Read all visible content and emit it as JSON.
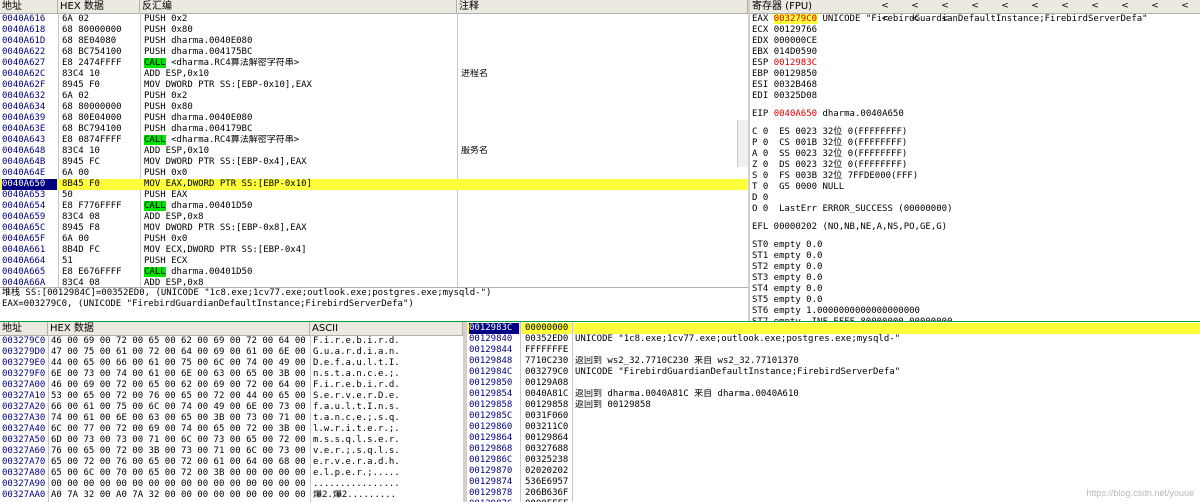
{
  "disasm": {
    "headers": {
      "addr": "地址",
      "hex": "HEX 数据",
      "asm": "反汇编",
      "comment": "注释"
    },
    "rows": [
      {
        "a": "0040A616",
        "h": "6A 02",
        "i": "PUSH 0x2",
        "c": ""
      },
      {
        "a": "0040A618",
        "h": "68 80000000",
        "i": "PUSH 0x80",
        "c": ""
      },
      {
        "a": "0040A61D",
        "h": "68 8E04080",
        "i": "PUSH dharma.0040E080",
        "c": ""
      },
      {
        "a": "0040A622",
        "h": "68 BC754100",
        "i": "PUSH dharma.004175BC",
        "c": ""
      },
      {
        "a": "0040A627",
        "h": "E8 2474FFFF",
        "i": "CALL <dharma.RC4算法解密字符串>",
        "c": "",
        "call": true
      },
      {
        "a": "0040A62C",
        "h": "83C4 10",
        "i": "ADD ESP,0x10",
        "c": "进程名"
      },
      {
        "a": "0040A62F",
        "h": "8945 F0",
        "i": "MOV DWORD PTR SS:[EBP-0x10],EAX",
        "c": ""
      },
      {
        "a": "0040A632",
        "h": "6A 02",
        "i": "PUSH 0x2",
        "c": ""
      },
      {
        "a": "0040A634",
        "h": "68 80000000",
        "i": "PUSH 0x80",
        "c": ""
      },
      {
        "a": "0040A639",
        "h": "68 80E04000",
        "i": "PUSH dharma.0040E080",
        "c": ""
      },
      {
        "a": "0040A63E",
        "h": "68 BC794100",
        "i": "PUSH dharma.004179BC",
        "c": ""
      },
      {
        "a": "0040A643",
        "h": "E8 0874FFFF",
        "i": "CALL <dharma.RC4算法解密字符串>",
        "c": "",
        "call": true
      },
      {
        "a": "0040A648",
        "h": "83C4 10",
        "i": "ADD ESP,0x10",
        "c": "服务名"
      },
      {
        "a": "0040A64B",
        "h": "8945 FC",
        "i": "MOV DWORD PTR SS:[EBP-0x4],EAX",
        "c": ""
      },
      {
        "a": "0040A64E",
        "h": "6A 00",
        "i": "PUSH 0x0",
        "c": ""
      },
      {
        "a": "0040A650",
        "h": "8B45 F0",
        "i": "MOV EAX,DWORD PTR SS:[EBP-0x10]",
        "c": "",
        "sel": true
      },
      {
        "a": "0040A653",
        "h": "50",
        "i": "PUSH EAX",
        "c": ""
      },
      {
        "a": "0040A654",
        "h": "E8 F776FFFF",
        "i": "CALL dharma.00401D50",
        "c": "",
        "call": true
      },
      {
        "a": "0040A659",
        "h": "83C4 08",
        "i": "ADD ESP,0x8",
        "c": ""
      },
      {
        "a": "0040A65C",
        "h": "8945 F8",
        "i": "MOV DWORD PTR SS:[EBP-0x8],EAX",
        "c": ""
      },
      {
        "a": "0040A65F",
        "h": "6A 00",
        "i": "PUSH 0x0",
        "c": ""
      },
      {
        "a": "0040A661",
        "h": "8B4D FC",
        "i": "MOV ECX,DWORD PTR SS:[EBP-0x4]",
        "c": ""
      },
      {
        "a": "0040A664",
        "h": "51",
        "i": "PUSH ECX",
        "c": ""
      },
      {
        "a": "0040A665",
        "h": "E8 E676FFFF",
        "i": "CALL dharma.00401D50",
        "c": "",
        "call": true
      },
      {
        "a": "0040A66A",
        "h": "83C4 08",
        "i": "ADD ESP,0x8",
        "c": ""
      }
    ]
  },
  "info": {
    "line1": "堆栈 SS:[0012984C]=00352ED0, (UNICODE \"1c8.exe;1cv77.exe;outlook.exe;postgres.exe;mysqld-\")",
    "line2": "EAX=003279C0, (UNICODE \"FirebirdGuardianDefaultInstance;FirebirdServerDefa\")"
  },
  "registers": {
    "title": "寄存器 (FPU)",
    "arrows": [
      "<",
      "<",
      "<",
      "<",
      "<",
      "<",
      "<",
      "<",
      "<",
      "<",
      "<",
      "<",
      "<",
      "<"
    ],
    "gp": [
      {
        "n": "EAX",
        "v": "003279C0",
        "x": "UNICODE \"FirebirdGuardianDefaultInstance;FirebirdServerDefa\"",
        "chg": true
      },
      {
        "n": "ECX",
        "v": "00129766",
        "x": ""
      },
      {
        "n": "EDX",
        "v": "000000CE",
        "x": ""
      },
      {
        "n": "EBX",
        "v": "014D0590",
        "x": ""
      },
      {
        "n": "ESP",
        "v": "0012983C",
        "x": "",
        "red": true
      },
      {
        "n": "EBP",
        "v": "00129850",
        "x": ""
      },
      {
        "n": "ESI",
        "v": "0032B468",
        "x": ""
      },
      {
        "n": "EDI",
        "v": "00325D08",
        "x": ""
      }
    ],
    "eip": {
      "n": "EIP",
      "v": "0040A650",
      "x": "dharma.0040A650"
    },
    "flags": [
      "C 0  ES 0023 32位 0(FFFFFFFF)",
      "P 0  CS 001B 32位 0(FFFFFFFF)",
      "A 0  SS 0023 32位 0(FFFFFFFF)",
      "Z 0  DS 0023 32位 0(FFFFFFFF)",
      "S 0  FS 003B 32位 7FFDE000(FFF)",
      "T 0  GS 0000 NULL",
      "D 0",
      "O 0  LastErr ERROR_SUCCESS (00000000)"
    ],
    "efl": "EFL 00000202 (NO,NB,NE,A,NS,PO,GE,G)",
    "fpu": [
      "ST0 empty 0.0",
      "ST1 empty 0.0",
      "ST2 empty 0.0",
      "ST3 empty 0.0",
      "ST4 empty 0.0",
      "ST5 empty 0.0",
      "ST6 empty 1.0000000000000000000",
      "ST7 empty -INF FFFF 80000000 00000000"
    ]
  },
  "dump": {
    "headers": {
      "addr": "地址",
      "hex": "HEX 数据",
      "ascii": "ASCII"
    },
    "rows": [
      {
        "a": "003279C0",
        "h": "46 00 69 00 72 00 65 00 62 00 69 00 72 00 64 00",
        "s": "F.i.r.e.b.i.r.d."
      },
      {
        "a": "003279D0",
        "h": "47 00 75 00 61 00 72 00 64 00 69 00 61 00 6E 00",
        "s": "G.u.a.r.d.i.a.n."
      },
      {
        "a": "003279E0",
        "h": "44 00 65 00 66 00 61 00 75 00 6C 00 74 00 49 00",
        "s": "D.e.f.a.u.l.t.I."
      },
      {
        "a": "003279F0",
        "h": "6E 00 73 00 74 00 61 00 6E 00 63 00 65 00 3B 00",
        "s": "n.s.t.a.n.c.e.;."
      },
      {
        "a": "00327A00",
        "h": "46 00 69 00 72 00 65 00 62 00 69 00 72 00 64 00",
        "s": "F.i.r.e.b.i.r.d."
      },
      {
        "a": "00327A10",
        "h": "53 00 65 00 72 00 76 00 65 00 72 00 44 00 65 00",
        "s": "S.e.r.v.e.r.D.e."
      },
      {
        "a": "00327A20",
        "h": "66 00 61 00 75 00 6C 00 74 00 49 00 6E 00 73 00",
        "s": "f.a.u.l.t.I.n.s."
      },
      {
        "a": "00327A30",
        "h": "74 00 61 00 6E 00 63 00 65 00 3B 00 73 00 71 00",
        "s": "t.a.n.c.e.;.s.q."
      },
      {
        "a": "00327A40",
        "h": "6C 00 77 00 72 00 69 00 74 00 65 00 72 00 3B 00",
        "s": "l.w.r.i.t.e.r.;."
      },
      {
        "a": "00327A50",
        "h": "6D 00 73 00 73 00 71 00 6C 00 73 00 65 00 72 00",
        "s": "m.s.s.q.l.s.e.r."
      },
      {
        "a": "00327A60",
        "h": "76 00 65 00 72 00 3B 00 73 00 71 00 6C 00 73 00",
        "s": "v.e.r.;.s.q.l.s."
      },
      {
        "a": "00327A70",
        "h": "65 00 72 00 76 00 65 00 72 00 61 00 64 00 68 00",
        "s": "e.r.v.e.r.a.d.h."
      },
      {
        "a": "00327A80",
        "h": "65 00 6C 00 70 00 65 00 72 00 3B 00 00 00 00 00",
        "s": "e.l.p.e.r.;....."
      },
      {
        "a": "00327A90",
        "h": "00 00 00 00 00 00 00 00 00 00 00 00 00 00 00 00",
        "s": "................"
      },
      {
        "a": "00327AA0",
        "h": "A0 7A 32 00 A0 7A 32 00 00 00 00 00 00 00 00 00",
        "s": "爗2.爗2........."
      }
    ]
  },
  "stack": {
    "rows": [
      {
        "a": "0012983C",
        "v": "00000000",
        "c": "",
        "sel": true
      },
      {
        "a": "00129840",
        "v": "00352ED0",
        "c": "UNICODE \"1c8.exe;1cv77.exe;outlook.exe;postgres.exe;mysqld-\""
      },
      {
        "a": "00129844",
        "v": "FFFFFFFE",
        "c": ""
      },
      {
        "a": "00129848",
        "v": "7710C230",
        "c": "返回到 ws2_32.7710C230 来自 ws2_32.77101370"
      },
      {
        "a": "0012984C",
        "v": "003279C0",
        "c": "UNICODE \"FirebirdGuardianDefaultInstance;FirebirdServerDefa\""
      },
      {
        "a": "00129850",
        "v": "00129A08",
        "c": ""
      },
      {
        "a": "00129854",
        "v": "0040A81C",
        "c": "返回到 dharma.0040A81C 来自 dharma.0040A610"
      },
      {
        "a": "00129858",
        "v": "00129858",
        "c": "返回到 00129858"
      },
      {
        "a": "0012985C",
        "v": "0031F060",
        "c": ""
      },
      {
        "a": "00129860",
        "v": "003211C0",
        "c": ""
      },
      {
        "a": "00129864",
        "v": "00129864",
        "c": ""
      },
      {
        "a": "00129868",
        "v": "00327688",
        "c": ""
      },
      {
        "a": "0012986C",
        "v": "00325238",
        "c": ""
      },
      {
        "a": "00129870",
        "v": "02020202",
        "c": ""
      },
      {
        "a": "00129874",
        "v": "536E6957",
        "c": ""
      },
      {
        "a": "00129878",
        "v": "206B636F",
        "c": ""
      },
      {
        "a": "0012987C",
        "v": "0000FFFF",
        "c": ""
      }
    ]
  },
  "watermark": "https://blog.csdn.net/youue"
}
